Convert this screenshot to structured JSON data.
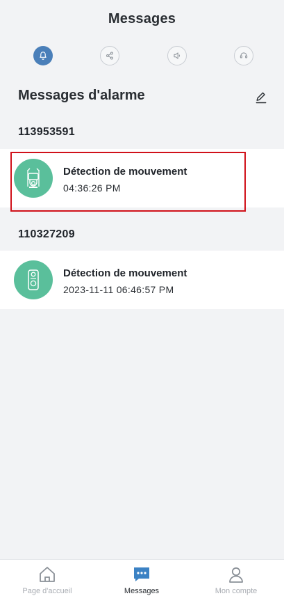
{
  "header": {
    "title": "Messages"
  },
  "tabs": [
    {
      "icon": "bell-icon",
      "active": true
    },
    {
      "icon": "share-icon",
      "active": false
    },
    {
      "icon": "speaker-icon",
      "active": false
    },
    {
      "icon": "support-icon",
      "active": false
    }
  ],
  "section": {
    "title": "Messages d'alarme",
    "edit_icon": "edit-icon"
  },
  "groups": [
    {
      "device_id": "113953591",
      "items": [
        {
          "event": "Détection de mouvement",
          "time": "04:36:26 PM",
          "icon": "camera-outdoor-icon"
        }
      ]
    },
    {
      "device_id": "110327209",
      "items": [
        {
          "event": "Détection de mouvement",
          "time": "2023-11-11 06:46:57 PM",
          "icon": "doorbell-icon"
        }
      ]
    }
  ],
  "bottom_nav": [
    {
      "label": "Page d'accueil",
      "icon": "home-icon",
      "active": false
    },
    {
      "label": "Messages",
      "icon": "chat-icon",
      "active": true
    },
    {
      "label": "Mon compte",
      "icon": "user-icon",
      "active": false
    }
  ],
  "colors": {
    "accent": "#4a7fb9",
    "avatar": "#5abf9b",
    "highlight": "#d0111a",
    "background": "#f2f3f5"
  }
}
